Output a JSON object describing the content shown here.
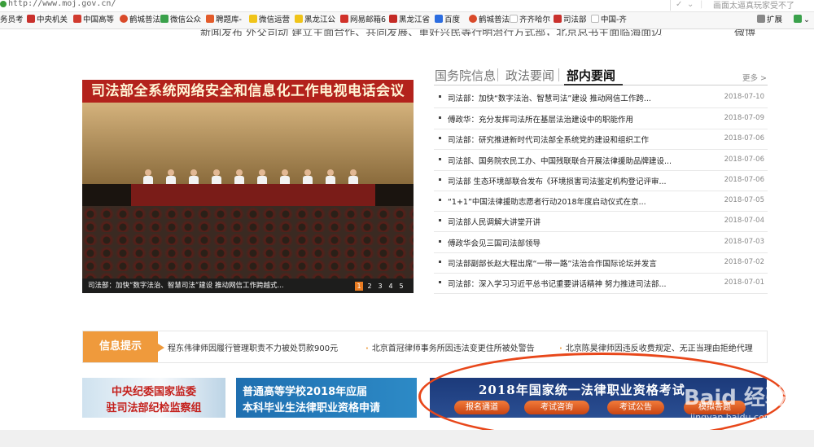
{
  "browser": {
    "url": "http://www.moj.gov.cn/",
    "search_text": "画面太逼真玩家受不了",
    "bookmarks": [
      "务员考",
      "中央机关",
      "中国高等",
      "鹤城普法",
      "微信公众",
      "聘题库-",
      "微信运营",
      "黑龙江公",
      "网易邮箱6",
      "黑龙江省",
      "百度",
      "鹤城普法",
      "齐齐哈尔",
      "司法部",
      "中国-齐"
    ],
    "extensions_label": "扩展"
  },
  "nav_cut": {
    "left_text": "新闻发布    外交司动    建立主面合作、共同发展、重好兴民等行明治行方式部，北京总书主面临海面边",
    "right_text": "微博"
  },
  "news": {
    "tabs": [
      "国务院信息",
      "政法要闻",
      "部内要闻"
    ],
    "more": "更多 >",
    "items": [
      {
        "title": "司法部：加快“数字法治、智慧司法”建设 推动网信工作跨...",
        "date": "2018-07-10"
      },
      {
        "title": "傅政华：充分发挥司法所在基层法治建设中的职能作用",
        "date": "2018-07-09"
      },
      {
        "title": "司法部：研究推进新时代司法部全系统党的建设和组织工作",
        "date": "2018-07-06"
      },
      {
        "title": "司法部、国务院农民工办、中国残联联合开展法律援助品牌建设...",
        "date": "2018-07-06"
      },
      {
        "title": "司法部 生态环境部联合发布《环境损害司法鉴定机构登记评审...",
        "date": "2018-07-06"
      },
      {
        "title": "“1+1”中国法律援助志愿者行动2018年度启动仪式在京...",
        "date": "2018-07-05"
      },
      {
        "title": "司法部人民调解大讲堂开讲",
        "date": "2018-07-04"
      },
      {
        "title": "傅政华会见三国司法部领导",
        "date": "2018-07-03"
      },
      {
        "title": "司法部副部长赵大程出席“一带一路”法治合作国际论坛并发言",
        "date": "2018-07-02"
      },
      {
        "title": "司法部：深入学习习近平总书记重要讲话精神 努力推进司法部...",
        "date": "2018-07-01"
      }
    ]
  },
  "photo": {
    "banner": "司法部全系统网络安全和信息化工作电视电话会议",
    "caption": "司法部：加快“数字法治、智慧司法”建设 推动网信工作跨越式...",
    "pages": [
      "1",
      "2",
      "3",
      "4",
      "5"
    ]
  },
  "info": {
    "label": "信息提示",
    "items": [
      "程东伟律师因履行管理职责不力被处罚款900元",
      "北京首冠律师事务所因违法变更住所被处警告",
      "北京陈昊律师因违反收费规定、无正当理由拒绝代理"
    ]
  },
  "ads": {
    "ad1": [
      "中央纪委国家监委",
      "驻司法部纪检监察组"
    ],
    "ad2": [
      "普通高等学校2018年应届",
      "本科毕业生法律职业资格申请"
    ],
    "ad3_title": "2018年国家统一法律职业资格考试",
    "ad3_buttons": [
      "报名通道",
      "考试咨询",
      "考试公告",
      "模拟答题"
    ]
  },
  "watermark": {
    "main": "Baid 经验",
    "sub": "jingyan.baidu.com"
  },
  "colors": {
    "accent_orange": "#ef9a3c",
    "banner_red": "#b3221c",
    "annotation_red": "#e8471a"
  }
}
